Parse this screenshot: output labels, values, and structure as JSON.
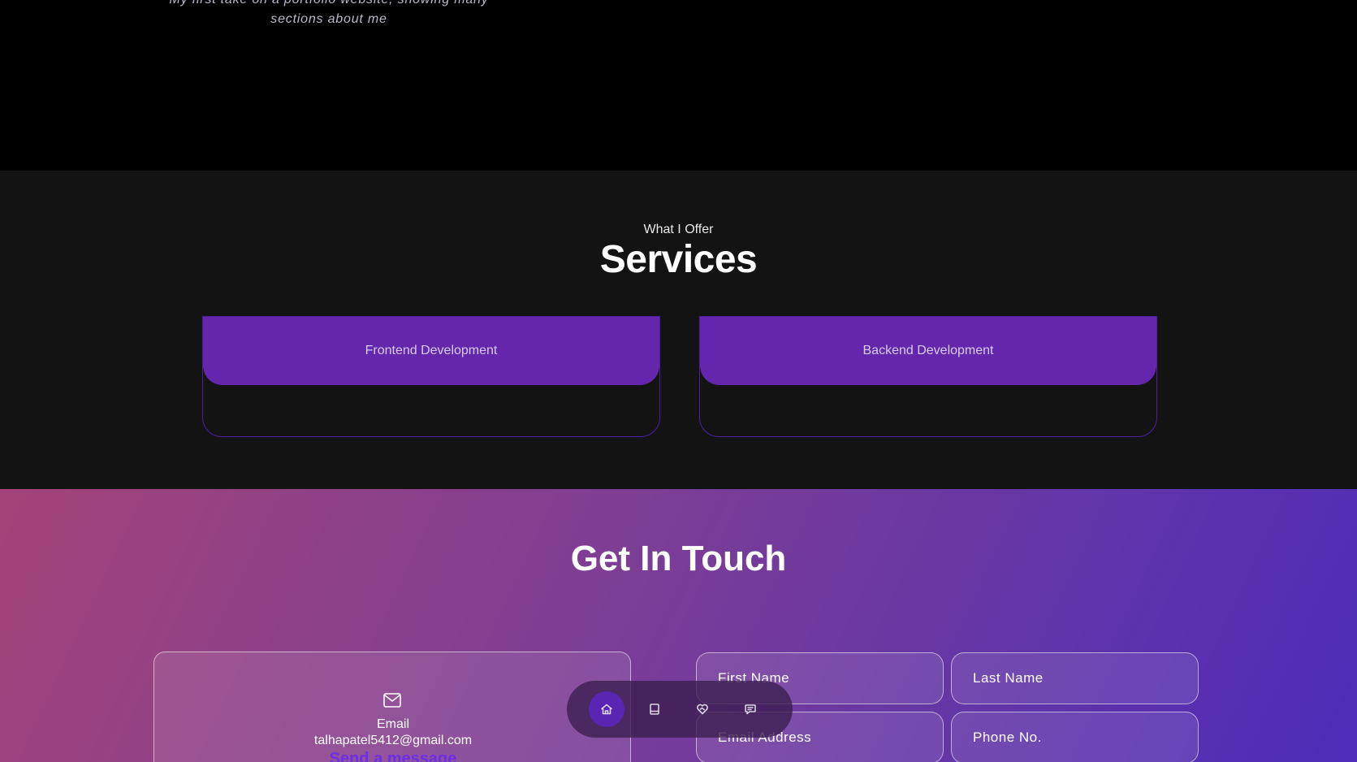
{
  "hero": {
    "tagline_line1": "My first take on a portfolio website, showing many",
    "tagline_line2": "sections about me"
  },
  "services": {
    "subtitle": "What I Offer",
    "title": "Services",
    "cards": [
      {
        "label": "Frontend Development"
      },
      {
        "label": "Backend Development"
      }
    ]
  },
  "contact": {
    "title": "Get In Touch",
    "email_card": {
      "icon": "mail-icon",
      "label": "Email",
      "value": "talhapatel5412@gmail.com",
      "link_text": "Send a message"
    },
    "form": {
      "first_name_placeholder": "First Name",
      "last_name_placeholder": "Last Name",
      "email_placeholder": "Email Address",
      "phone_placeholder": "Phone No."
    }
  },
  "dock": {
    "items": [
      {
        "icon": "home-icon",
        "active": true
      },
      {
        "icon": "book-icon",
        "active": false
      },
      {
        "icon": "handshake-heart-icon",
        "active": false
      },
      {
        "icon": "message-icon",
        "active": false
      }
    ]
  },
  "colors": {
    "accent_purple": "#6426ad",
    "dock_active": "#5a25b2",
    "link_purple": "#6d2fe6"
  }
}
